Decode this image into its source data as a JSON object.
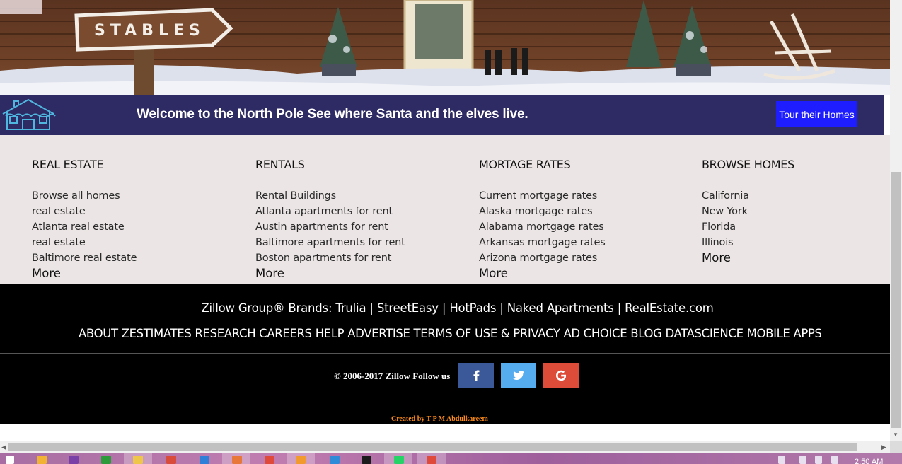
{
  "hero": {
    "sign_text": "STABLES"
  },
  "banner": {
    "text": "Welcome to the North Pole See where Santa and the elves live.",
    "button_label": "Tour their Homes"
  },
  "columns": [
    {
      "title": "REAL ESTATE",
      "links": [
        "Browse all homes",
        "real estate",
        "Atlanta real estate",
        "real estate",
        "Baltimore real estate"
      ],
      "more": "More"
    },
    {
      "title": "RENTALS",
      "links": [
        "Rental Buildings",
        "Atlanta apartments for rent",
        "Austin apartments for rent",
        "Baltimore apartments for rent",
        "Boston apartments for rent"
      ],
      "more": "More"
    },
    {
      "title": "MORTAGE RATES",
      "links": [
        "Current mortgage rates",
        "Alaska mortgage rates",
        "Alabama mortgage rates",
        "Arkansas mortgage rates",
        "Arizona mortgage rates"
      ],
      "more": "More"
    },
    {
      "title": "BROWSE HOMES",
      "links": [
        "California",
        "New York",
        "Florida",
        "Illinois"
      ],
      "more": "More"
    }
  ],
  "footer": {
    "brands_prefix": "Zillow Group® Brands:",
    "brands": [
      "Trulia",
      "StreetEasy",
      "HotPads",
      "Naked Apartments",
      "RealEstate.com"
    ],
    "separator": "|",
    "nav": [
      "ABOUT",
      "ZESTIMATES",
      "RESEARCH",
      "CAREERS",
      "HELP",
      "ADVERTISE",
      "TERMS OF USE & PRIVACY",
      "AD CHOICE",
      "BLOG",
      "DATASCIENCE",
      "MOBILE APPS"
    ],
    "copyright": "© 2006-2017 Zillow",
    "follow_label": "Follow us",
    "credit": "Created by T P M Abdulkareem"
  },
  "taskbar": {
    "clock": "2:50 AM"
  },
  "colors": {
    "banner_bg": "#2e2a63",
    "button_bg": "#1d1dff",
    "links_bg": "#ebe5e5",
    "facebook": "#3b5998",
    "twitter": "#55acee",
    "google": "#dd4b39",
    "credit": "#ff8c1a"
  }
}
